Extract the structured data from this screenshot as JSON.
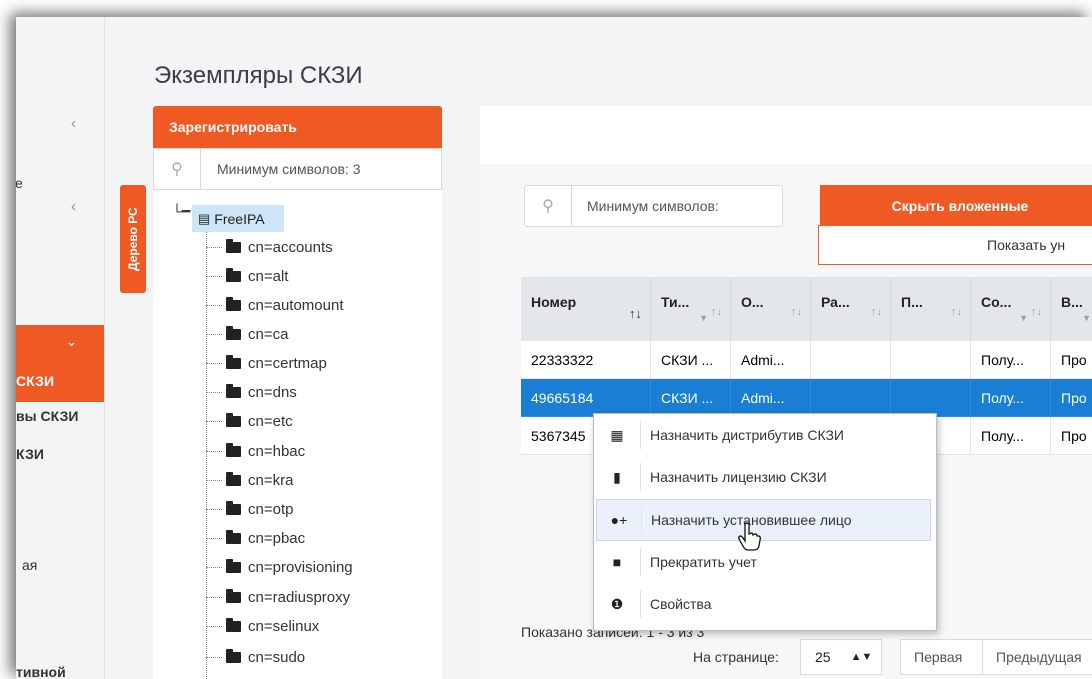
{
  "page": {
    "title": "Экземпляры СКЗИ"
  },
  "sidebar": {
    "items": [
      "е",
      "СКЗИ",
      "вы СКЗИ",
      "КЗИ",
      "ая",
      "тивной"
    ]
  },
  "left_panel": {
    "register_button": "Зарегистрировать",
    "search_placeholder": "Минимум символов: 3",
    "tree_tab": "Дерево РС",
    "root": "FreeIPA",
    "nodes": [
      "cn=accounts",
      "cn=alt",
      "cn=automount",
      "cn=ca",
      "cn=certmap",
      "cn=dns",
      "cn=etc",
      "cn=hbac",
      "cn=kra",
      "cn=otp",
      "cn=pbac",
      "cn=provisioning",
      "cn=radiusproxy",
      "cn=selinux",
      "cn=sudo"
    ]
  },
  "main": {
    "search_placeholder": "Минимум символов:",
    "hide_nested": "Скрыть вложенные",
    "show_button": "Показать ун",
    "columns": [
      "Номер",
      "Ти...",
      "О...",
      "Ра...",
      "П...",
      "Со...",
      "В..."
    ],
    "rows": [
      [
        "22333322",
        "СКЗИ ...",
        "Admi...",
        "",
        "",
        "Полу...",
        "Про"
      ],
      [
        "49665184",
        "СКЗИ ...",
        "Admi...",
        "",
        "",
        "Полу...",
        "Про"
      ],
      [
        "5367345",
        "",
        "",
        "",
        "",
        "Полу...",
        "Про"
      ]
    ],
    "selected_row": 1,
    "records_text": "Показано записей: 1 - 3 из 3",
    "per_page_label": "На странице:",
    "per_page_value": "25",
    "pager_first": "Первая",
    "pager_prev": "Предыдущая"
  },
  "context_menu": {
    "items": [
      "Назначить дистрибутив СКЗИ",
      "Назначить лицензию СКЗИ",
      "Назначить установившее лицо",
      "Прекратить учет",
      "Свойства"
    ],
    "hovered": 2
  },
  "colors": {
    "accent": "#ef5a24",
    "selection": "#1a7fd4"
  }
}
